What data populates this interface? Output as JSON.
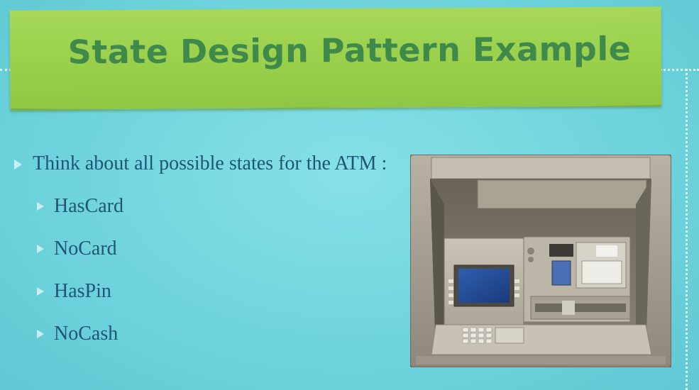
{
  "slide": {
    "title": "State Design Pattern Example",
    "main_bullet": "Think about all possible states for the ATM :",
    "sub_bullets": [
      "HasCard",
      "NoCard",
      "HasPin",
      "NoCash"
    ]
  },
  "image": {
    "icon": "atm-machine-icon"
  },
  "colors": {
    "background": "#6fd3dc",
    "banner": "#9bd04d",
    "title_text": "#3f8a4a",
    "body_text": "#1f5574"
  }
}
